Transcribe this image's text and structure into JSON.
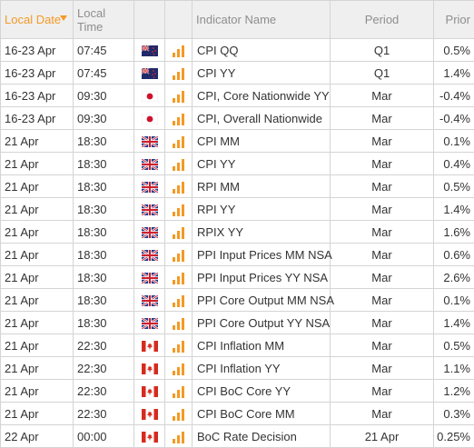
{
  "header": {
    "local_date": "Local Date",
    "local_time": "Local Time",
    "indicator_name": "Indicator Name",
    "period": "Period",
    "prior": "Prior"
  },
  "colors": {
    "accent": "#f39a26",
    "header_bg": "#efefef",
    "grid": "#d4d4d4",
    "importance_bar": "#f39a26"
  },
  "rows": [
    {
      "date": "16-23 Apr",
      "time": "07:45",
      "country": "nz-flag",
      "importance": 3,
      "name": "CPI QQ",
      "period": "Q1",
      "prior": "0.5%"
    },
    {
      "date": "16-23 Apr",
      "time": "07:45",
      "country": "nz-flag",
      "importance": 3,
      "name": "CPI YY",
      "period": "Q1",
      "prior": "1.4%"
    },
    {
      "date": "16-23 Apr",
      "time": "09:30",
      "country": "jp-flag",
      "importance": 3,
      "name": "CPI, Core Nationwide YY",
      "period": "Mar",
      "prior": "-0.4%"
    },
    {
      "date": "16-23 Apr",
      "time": "09:30",
      "country": "jp-flag",
      "importance": 3,
      "name": "CPI, Overall Nationwide",
      "period": "Mar",
      "prior": "-0.4%"
    },
    {
      "date": "21 Apr",
      "time": "18:30",
      "country": "uk-flag",
      "importance": 3,
      "name": "CPI MM",
      "period": "Mar",
      "prior": "0.1%"
    },
    {
      "date": "21 Apr",
      "time": "18:30",
      "country": "uk-flag",
      "importance": 3,
      "name": "CPI YY",
      "period": "Mar",
      "prior": "0.4%"
    },
    {
      "date": "21 Apr",
      "time": "18:30",
      "country": "uk-flag",
      "importance": 3,
      "name": "RPI MM",
      "period": "Mar",
      "prior": "0.5%"
    },
    {
      "date": "21 Apr",
      "time": "18:30",
      "country": "uk-flag",
      "importance": 3,
      "name": "RPI YY",
      "period": "Mar",
      "prior": "1.4%"
    },
    {
      "date": "21 Apr",
      "time": "18:30",
      "country": "uk-flag",
      "importance": 3,
      "name": "RPIX YY",
      "period": "Mar",
      "prior": "1.6%"
    },
    {
      "date": "21 Apr",
      "time": "18:30",
      "country": "uk-flag",
      "importance": 3,
      "name": "PPI Input Prices MM NSA",
      "period": "Mar",
      "prior": "0.6%"
    },
    {
      "date": "21 Apr",
      "time": "18:30",
      "country": "uk-flag",
      "importance": 3,
      "name": "PPI Input Prices YY NSA",
      "period": "Mar",
      "prior": "2.6%"
    },
    {
      "date": "21 Apr",
      "time": "18:30",
      "country": "uk-flag",
      "importance": 3,
      "name": "PPI Core Output MM NSA",
      "period": "Mar",
      "prior": "0.1%"
    },
    {
      "date": "21 Apr",
      "time": "18:30",
      "country": "uk-flag",
      "importance": 3,
      "name": "PPI Core Output YY NSA",
      "period": "Mar",
      "prior": "1.4%"
    },
    {
      "date": "21 Apr",
      "time": "22:30",
      "country": "ca-flag",
      "importance": 3,
      "name": "CPI Inflation MM",
      "period": "Mar",
      "prior": "0.5%"
    },
    {
      "date": "21 Apr",
      "time": "22:30",
      "country": "ca-flag",
      "importance": 3,
      "name": "CPI Inflation YY",
      "period": "Mar",
      "prior": "1.1%"
    },
    {
      "date": "21 Apr",
      "time": "22:30",
      "country": "ca-flag",
      "importance": 3,
      "name": "CPI BoC Core YY",
      "period": "Mar",
      "prior": "1.2%"
    },
    {
      "date": "21 Apr",
      "time": "22:30",
      "country": "ca-flag",
      "importance": 3,
      "name": "CPI BoC Core MM",
      "period": "Mar",
      "prior": "0.3%"
    },
    {
      "date": "22 Apr",
      "time": "00:00",
      "country": "ca-flag",
      "importance": 3,
      "name": "BoC Rate Decision",
      "period": "21 Apr",
      "prior": "0.25%"
    }
  ]
}
